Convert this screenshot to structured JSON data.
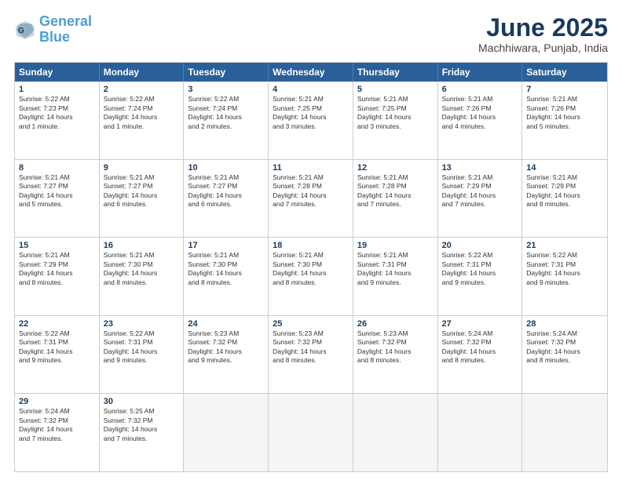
{
  "header": {
    "logo_line1": "General",
    "logo_line2": "Blue",
    "month": "June 2025",
    "location": "Machhiwara, Punjab, India"
  },
  "weekdays": [
    "Sunday",
    "Monday",
    "Tuesday",
    "Wednesday",
    "Thursday",
    "Friday",
    "Saturday"
  ],
  "rows": [
    [
      {
        "day": "1",
        "lines": [
          "Sunrise: 5:22 AM",
          "Sunset: 7:23 PM",
          "Daylight: 14 hours",
          "and 1 minute."
        ]
      },
      {
        "day": "2",
        "lines": [
          "Sunrise: 5:22 AM",
          "Sunset: 7:24 PM",
          "Daylight: 14 hours",
          "and 1 minute."
        ]
      },
      {
        "day": "3",
        "lines": [
          "Sunrise: 5:22 AM",
          "Sunset: 7:24 PM",
          "Daylight: 14 hours",
          "and 2 minutes."
        ]
      },
      {
        "day": "4",
        "lines": [
          "Sunrise: 5:21 AM",
          "Sunset: 7:25 PM",
          "Daylight: 14 hours",
          "and 3 minutes."
        ]
      },
      {
        "day": "5",
        "lines": [
          "Sunrise: 5:21 AM",
          "Sunset: 7:25 PM",
          "Daylight: 14 hours",
          "and 3 minutes."
        ]
      },
      {
        "day": "6",
        "lines": [
          "Sunrise: 5:21 AM",
          "Sunset: 7:26 PM",
          "Daylight: 14 hours",
          "and 4 minutes."
        ]
      },
      {
        "day": "7",
        "lines": [
          "Sunrise: 5:21 AM",
          "Sunset: 7:26 PM",
          "Daylight: 14 hours",
          "and 5 minutes."
        ]
      }
    ],
    [
      {
        "day": "8",
        "lines": [
          "Sunrise: 5:21 AM",
          "Sunset: 7:27 PM",
          "Daylight: 14 hours",
          "and 5 minutes."
        ]
      },
      {
        "day": "9",
        "lines": [
          "Sunrise: 5:21 AM",
          "Sunset: 7:27 PM",
          "Daylight: 14 hours",
          "and 6 minutes."
        ]
      },
      {
        "day": "10",
        "lines": [
          "Sunrise: 5:21 AM",
          "Sunset: 7:27 PM",
          "Daylight: 14 hours",
          "and 6 minutes."
        ]
      },
      {
        "day": "11",
        "lines": [
          "Sunrise: 5:21 AM",
          "Sunset: 7:28 PM",
          "Daylight: 14 hours",
          "and 7 minutes."
        ]
      },
      {
        "day": "12",
        "lines": [
          "Sunrise: 5:21 AM",
          "Sunset: 7:28 PM",
          "Daylight: 14 hours",
          "and 7 minutes."
        ]
      },
      {
        "day": "13",
        "lines": [
          "Sunrise: 5:21 AM",
          "Sunset: 7:29 PM",
          "Daylight: 14 hours",
          "and 7 minutes."
        ]
      },
      {
        "day": "14",
        "lines": [
          "Sunrise: 5:21 AM",
          "Sunset: 7:29 PM",
          "Daylight: 14 hours",
          "and 8 minutes."
        ]
      }
    ],
    [
      {
        "day": "15",
        "lines": [
          "Sunrise: 5:21 AM",
          "Sunset: 7:29 PM",
          "Daylight: 14 hours",
          "and 8 minutes."
        ]
      },
      {
        "day": "16",
        "lines": [
          "Sunrise: 5:21 AM",
          "Sunset: 7:30 PM",
          "Daylight: 14 hours",
          "and 8 minutes."
        ]
      },
      {
        "day": "17",
        "lines": [
          "Sunrise: 5:21 AM",
          "Sunset: 7:30 PM",
          "Daylight: 14 hours",
          "and 8 minutes."
        ]
      },
      {
        "day": "18",
        "lines": [
          "Sunrise: 5:21 AM",
          "Sunset: 7:30 PM",
          "Daylight: 14 hours",
          "and 8 minutes."
        ]
      },
      {
        "day": "19",
        "lines": [
          "Sunrise: 5:21 AM",
          "Sunset: 7:31 PM",
          "Daylight: 14 hours",
          "and 9 minutes."
        ]
      },
      {
        "day": "20",
        "lines": [
          "Sunrise: 5:22 AM",
          "Sunset: 7:31 PM",
          "Daylight: 14 hours",
          "and 9 minutes."
        ]
      },
      {
        "day": "21",
        "lines": [
          "Sunrise: 5:22 AM",
          "Sunset: 7:31 PM",
          "Daylight: 14 hours",
          "and 9 minutes."
        ]
      }
    ],
    [
      {
        "day": "22",
        "lines": [
          "Sunrise: 5:22 AM",
          "Sunset: 7:31 PM",
          "Daylight: 14 hours",
          "and 9 minutes."
        ]
      },
      {
        "day": "23",
        "lines": [
          "Sunrise: 5:22 AM",
          "Sunset: 7:31 PM",
          "Daylight: 14 hours",
          "and 9 minutes."
        ]
      },
      {
        "day": "24",
        "lines": [
          "Sunrise: 5:23 AM",
          "Sunset: 7:32 PM",
          "Daylight: 14 hours",
          "and 9 minutes."
        ]
      },
      {
        "day": "25",
        "lines": [
          "Sunrise: 5:23 AM",
          "Sunset: 7:32 PM",
          "Daylight: 14 hours",
          "and 8 minutes."
        ]
      },
      {
        "day": "26",
        "lines": [
          "Sunrise: 5:23 AM",
          "Sunset: 7:32 PM",
          "Daylight: 14 hours",
          "and 8 minutes."
        ]
      },
      {
        "day": "27",
        "lines": [
          "Sunrise: 5:24 AM",
          "Sunset: 7:32 PM",
          "Daylight: 14 hours",
          "and 8 minutes."
        ]
      },
      {
        "day": "28",
        "lines": [
          "Sunrise: 5:24 AM",
          "Sunset: 7:32 PM",
          "Daylight: 14 hours",
          "and 8 minutes."
        ]
      }
    ],
    [
      {
        "day": "29",
        "lines": [
          "Sunrise: 5:24 AM",
          "Sunset: 7:32 PM",
          "Daylight: 14 hours",
          "and 7 minutes."
        ]
      },
      {
        "day": "30",
        "lines": [
          "Sunrise: 5:25 AM",
          "Sunset: 7:32 PM",
          "Daylight: 14 hours",
          "and 7 minutes."
        ]
      },
      {
        "day": "",
        "lines": []
      },
      {
        "day": "",
        "lines": []
      },
      {
        "day": "",
        "lines": []
      },
      {
        "day": "",
        "lines": []
      },
      {
        "day": "",
        "lines": []
      }
    ]
  ]
}
